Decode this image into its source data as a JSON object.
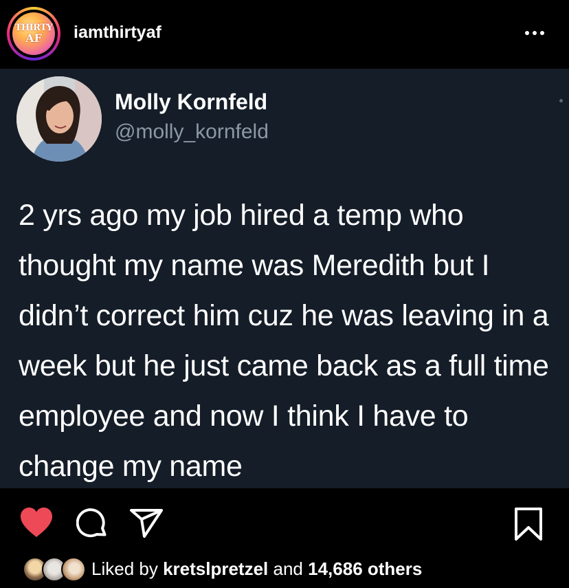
{
  "header": {
    "account_logo_text_top": "THIRTY",
    "account_logo_text_bottom": "AF",
    "username": "iamthirtyaf"
  },
  "tweet": {
    "name": "Molly Kornfeld",
    "handle": "@molly_kornfeld",
    "text": "2 yrs ago my job hired a temp who thought my name was Meredith but I didn’t correct him cuz he was leaving in a week but he just came back as a full time employee and now I think I have to change my name",
    "background_color": "#151d28"
  },
  "actions": {
    "like_icon": "heart-icon",
    "like_color": "#ed4956",
    "comment_icon": "comment-icon",
    "share_icon": "share-icon",
    "save_icon": "bookmark-icon"
  },
  "likes": {
    "prefix": "Liked by",
    "user": "kretslpretzel",
    "middle": "and",
    "count_text": "14,686 others"
  }
}
